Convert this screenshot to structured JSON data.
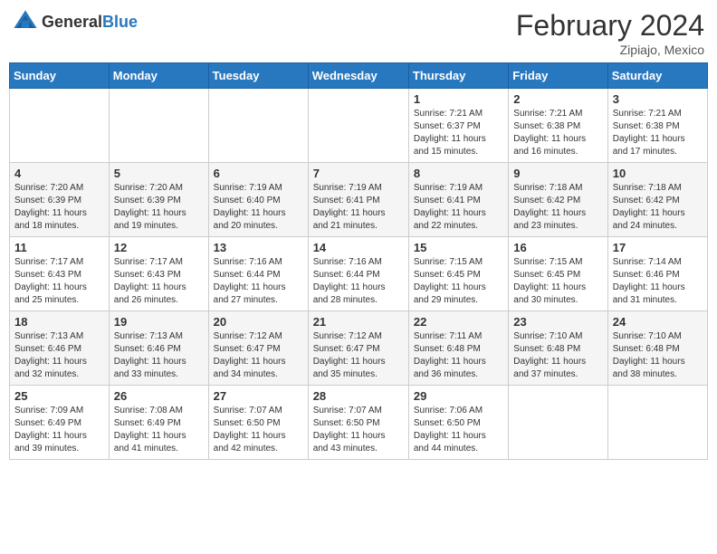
{
  "header": {
    "logo_general": "General",
    "logo_blue": "Blue",
    "title": "February 2024",
    "subtitle": "Zipiajo, Mexico"
  },
  "weekdays": [
    "Sunday",
    "Monday",
    "Tuesday",
    "Wednesday",
    "Thursday",
    "Friday",
    "Saturday"
  ],
  "weeks": [
    [
      {
        "day": "",
        "info": ""
      },
      {
        "day": "",
        "info": ""
      },
      {
        "day": "",
        "info": ""
      },
      {
        "day": "",
        "info": ""
      },
      {
        "day": "1",
        "info": "Sunrise: 7:21 AM\nSunset: 6:37 PM\nDaylight: 11 hours\nand 15 minutes."
      },
      {
        "day": "2",
        "info": "Sunrise: 7:21 AM\nSunset: 6:38 PM\nDaylight: 11 hours\nand 16 minutes."
      },
      {
        "day": "3",
        "info": "Sunrise: 7:21 AM\nSunset: 6:38 PM\nDaylight: 11 hours\nand 17 minutes."
      }
    ],
    [
      {
        "day": "4",
        "info": "Sunrise: 7:20 AM\nSunset: 6:39 PM\nDaylight: 11 hours\nand 18 minutes."
      },
      {
        "day": "5",
        "info": "Sunrise: 7:20 AM\nSunset: 6:39 PM\nDaylight: 11 hours\nand 19 minutes."
      },
      {
        "day": "6",
        "info": "Sunrise: 7:19 AM\nSunset: 6:40 PM\nDaylight: 11 hours\nand 20 minutes."
      },
      {
        "day": "7",
        "info": "Sunrise: 7:19 AM\nSunset: 6:41 PM\nDaylight: 11 hours\nand 21 minutes."
      },
      {
        "day": "8",
        "info": "Sunrise: 7:19 AM\nSunset: 6:41 PM\nDaylight: 11 hours\nand 22 minutes."
      },
      {
        "day": "9",
        "info": "Sunrise: 7:18 AM\nSunset: 6:42 PM\nDaylight: 11 hours\nand 23 minutes."
      },
      {
        "day": "10",
        "info": "Sunrise: 7:18 AM\nSunset: 6:42 PM\nDaylight: 11 hours\nand 24 minutes."
      }
    ],
    [
      {
        "day": "11",
        "info": "Sunrise: 7:17 AM\nSunset: 6:43 PM\nDaylight: 11 hours\nand 25 minutes."
      },
      {
        "day": "12",
        "info": "Sunrise: 7:17 AM\nSunset: 6:43 PM\nDaylight: 11 hours\nand 26 minutes."
      },
      {
        "day": "13",
        "info": "Sunrise: 7:16 AM\nSunset: 6:44 PM\nDaylight: 11 hours\nand 27 minutes."
      },
      {
        "day": "14",
        "info": "Sunrise: 7:16 AM\nSunset: 6:44 PM\nDaylight: 11 hours\nand 28 minutes."
      },
      {
        "day": "15",
        "info": "Sunrise: 7:15 AM\nSunset: 6:45 PM\nDaylight: 11 hours\nand 29 minutes."
      },
      {
        "day": "16",
        "info": "Sunrise: 7:15 AM\nSunset: 6:45 PM\nDaylight: 11 hours\nand 30 minutes."
      },
      {
        "day": "17",
        "info": "Sunrise: 7:14 AM\nSunset: 6:46 PM\nDaylight: 11 hours\nand 31 minutes."
      }
    ],
    [
      {
        "day": "18",
        "info": "Sunrise: 7:13 AM\nSunset: 6:46 PM\nDaylight: 11 hours\nand 32 minutes."
      },
      {
        "day": "19",
        "info": "Sunrise: 7:13 AM\nSunset: 6:46 PM\nDaylight: 11 hours\nand 33 minutes."
      },
      {
        "day": "20",
        "info": "Sunrise: 7:12 AM\nSunset: 6:47 PM\nDaylight: 11 hours\nand 34 minutes."
      },
      {
        "day": "21",
        "info": "Sunrise: 7:12 AM\nSunset: 6:47 PM\nDaylight: 11 hours\nand 35 minutes."
      },
      {
        "day": "22",
        "info": "Sunrise: 7:11 AM\nSunset: 6:48 PM\nDaylight: 11 hours\nand 36 minutes."
      },
      {
        "day": "23",
        "info": "Sunrise: 7:10 AM\nSunset: 6:48 PM\nDaylight: 11 hours\nand 37 minutes."
      },
      {
        "day": "24",
        "info": "Sunrise: 7:10 AM\nSunset: 6:48 PM\nDaylight: 11 hours\nand 38 minutes."
      }
    ],
    [
      {
        "day": "25",
        "info": "Sunrise: 7:09 AM\nSunset: 6:49 PM\nDaylight: 11 hours\nand 39 minutes."
      },
      {
        "day": "26",
        "info": "Sunrise: 7:08 AM\nSunset: 6:49 PM\nDaylight: 11 hours\nand 41 minutes."
      },
      {
        "day": "27",
        "info": "Sunrise: 7:07 AM\nSunset: 6:50 PM\nDaylight: 11 hours\nand 42 minutes."
      },
      {
        "day": "28",
        "info": "Sunrise: 7:07 AM\nSunset: 6:50 PM\nDaylight: 11 hours\nand 43 minutes."
      },
      {
        "day": "29",
        "info": "Sunrise: 7:06 AM\nSunset: 6:50 PM\nDaylight: 11 hours\nand 44 minutes."
      },
      {
        "day": "",
        "info": ""
      },
      {
        "day": "",
        "info": ""
      }
    ]
  ]
}
